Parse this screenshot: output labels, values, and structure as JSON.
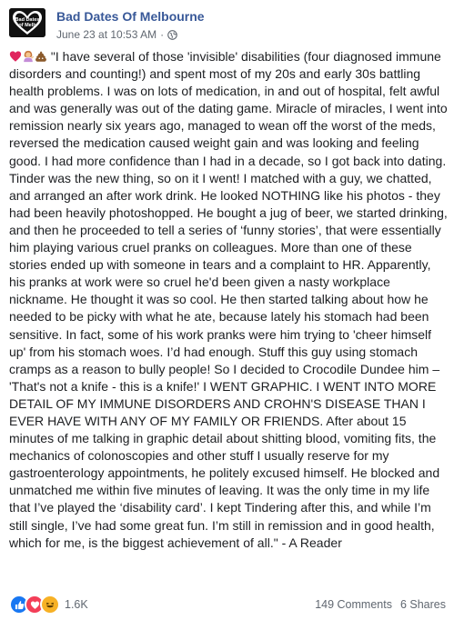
{
  "post": {
    "page_name": "Bad Dates Of Melbourne",
    "avatar_text": [
      "Bad Dates",
      "of Melb"
    ],
    "timestamp": "June 23 at 10:53 AM",
    "separator": "·",
    "privacy_icon": "globe-icon",
    "body_emojis": [
      "red-heart",
      "woman-tipping-hand",
      "pile-of-poo"
    ],
    "body": "\"I have several of those 'invisible' disabilities (four diagnosed immune disorders and counting!) and spent most of my 20s and early 30s battling health problems. I was on lots of medication, in and out of hospital, felt awful and was generally was out of the dating game. Miracle of miracles, I went into remission nearly six years ago, managed to wean off the worst of the meds, reversed the medication caused weight gain and was looking and feeling good. I had more confidence than I had in a decade, so I got back into dating. Tinder was the new thing, so on it I went! I matched with a guy, we chatted, and arranged an after work drink. He looked NOTHING like his photos - they had been heavily photoshopped. He bought a jug of beer, we started drinking, and then he proceeded to tell a series of ‘funny stories’, that were essentially him playing various cruel pranks on colleagues. More than one of these stories ended up with someone in tears and a complaint to HR. Apparently, his pranks at work were so cruel he'd been given a nasty workplace nickname. He thought it was so cool. He then started talking about how he needed to be picky with what he ate, because lately his stomach had been sensitive. In fact, some of his work pranks were him trying to 'cheer himself up' from his stomach woes. I’d had enough. Stuff this guy using stomach cramps as a reason to bully people! So I decided to Crocodile Dundee him – 'That's not a knife - this is a knife!' I WENT GRAPHIC. I WENT INTO MORE DETAIL OF MY IMMUNE DISORDERS AND CROHN'S DISEASE THAN I EVER HAVE WITH ANY OF MY FAMILY OR FRIENDS. After about 15 minutes of me talking in graphic detail about shitting blood, vomiting fits, the mechanics of colonoscopies and other stuff I usually reserve for my gastroenterology appointments, he politely excused himself. He blocked and unmatched me within five minutes of leaving. It was the only time in my life that I’ve played the ‘disability card’. I kept Tindering after this, and while I’m still single, I’ve had some great fun. I’m still in remission and in good health, which for me, is the biggest achievement of all.\" - A Reader"
  },
  "footer": {
    "reaction_icons": [
      "like-icon",
      "love-icon",
      "haha-icon"
    ],
    "reaction_count": "1.6K",
    "comments": "149 Comments",
    "shares": "6 Shares"
  },
  "colors": {
    "link": "#385898",
    "meta_text": "#606770",
    "body_text": "#1c1e21",
    "like": "#1877f2",
    "love": "#f33e58",
    "haha": "#f7b125"
  }
}
